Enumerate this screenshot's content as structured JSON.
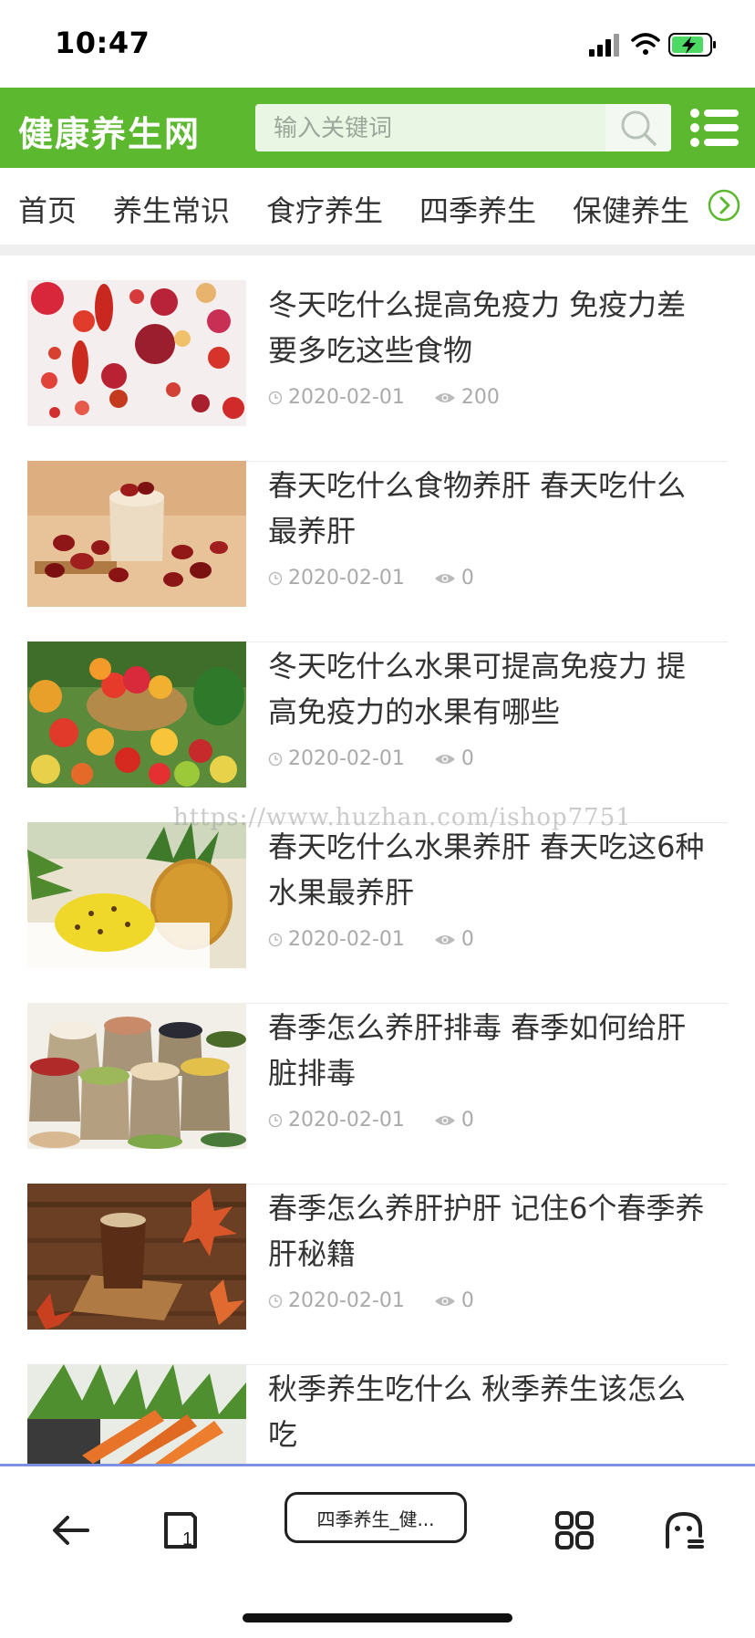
{
  "status": {
    "time": "10:47"
  },
  "header": {
    "title": "健康养生网",
    "search_placeholder": "输入关键词",
    "search_icon": "search-icon",
    "menu_icon": "menu-icon",
    "brand_color": "#5cb82f"
  },
  "nav": {
    "items": [
      "首页",
      "养生常识",
      "食疗养生",
      "四季养生",
      "保健养生"
    ],
    "more_icon": "chevron-right-icon"
  },
  "articles": [
    {
      "title": "冬天吃什么提高免疫力 免疫力差要多吃这些食物",
      "date": "2020-02-01",
      "views": "200"
    },
    {
      "title": "春天吃什么食物养肝 春天吃什么最养肝",
      "date": "2020-02-01",
      "views": "0"
    },
    {
      "title": "冬天吃什么水果可提高免疫力 提高免疫力的水果有哪些",
      "date": "2020-02-01",
      "views": "0"
    },
    {
      "title": "春天吃什么水果养肝 春天吃这6种水果最养肝",
      "date": "2020-02-01",
      "views": "0"
    },
    {
      "title": "春季怎么养肝排毒 春季如何给肝脏排毒",
      "date": "2020-02-01",
      "views": "0"
    },
    {
      "title": "春季怎么养肝护肝 记住6个春季养肝秘籍",
      "date": "2020-02-01",
      "views": "0"
    },
    {
      "title": "秋季养生吃什么 秋季养生该怎么吃",
      "date": "",
      "views": ""
    }
  ],
  "watermark": "https://www.huzhan.com/ishop7751",
  "browser": {
    "page_tab": "四季养生_健...",
    "back_icon": "back-arrow-icon",
    "tabs_icon": "tabs-icon",
    "grid_icon": "grid-icon",
    "ghost_icon": "ghost-icon"
  }
}
